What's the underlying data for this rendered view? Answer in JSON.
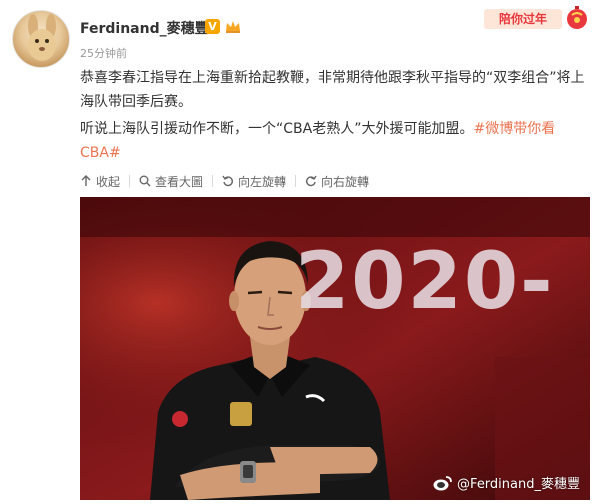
{
  "user": {
    "name": "Ferdinand_麥穗豐",
    "verified_badge": "V",
    "posted_ago": "25分钟前"
  },
  "promo": {
    "label": "陪你过年"
  },
  "post": {
    "paragraph1": "恭喜李春江指导在上海重新拾起教鞭，非常期待他跟李秋平指导的“双李组合”将上海队带回季后赛。",
    "paragraph2_text": "听说上海队引援动作不断，一个“CBA老熟人”大外援可能加盟。",
    "hashtag": "#微博带你看CBA#"
  },
  "actions": [
    {
      "label": "收起",
      "icon": "collapse-icon"
    },
    {
      "label": "查看大圖",
      "icon": "magnify-icon"
    },
    {
      "label": "向左旋轉",
      "icon": "rotate-left-icon"
    },
    {
      "label": "向右旋轉",
      "icon": "rotate-right-icon"
    }
  ],
  "photo": {
    "backdrop_text": "2020-",
    "watermark": "@Ferdinand_麥穗豐"
  },
  "colors": {
    "hashtag": "#eb7350",
    "username": "#333333",
    "timestamp": "#999999",
    "vip": "#f7a600"
  }
}
